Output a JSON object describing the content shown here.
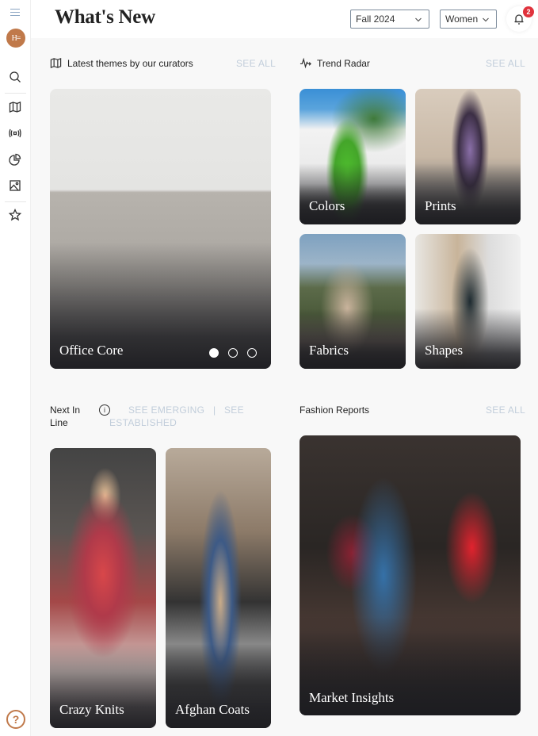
{
  "sidebar": {
    "logo_text": "H=",
    "icons": [
      "menu-icon",
      "search-icon",
      "map-icon",
      "radar-icon",
      "pie-chart-icon",
      "image-icon",
      "star-icon",
      "help-icon"
    ],
    "help_label": "?"
  },
  "header": {
    "title": "What's New",
    "season_select": {
      "value": "Fall 2024"
    },
    "gender_select": {
      "value": "Women"
    },
    "notifications": {
      "count": "2"
    }
  },
  "sections": {
    "latest_themes": {
      "title": "Latest themes by our curators",
      "see_all": "SEE ALL",
      "carousel": {
        "label": "Office Core",
        "slides": 3,
        "active_slide": 1
      }
    },
    "trend_radar": {
      "title": "Trend Radar",
      "see_all": "SEE ALL",
      "cards": [
        {
          "label": "Colors"
        },
        {
          "label": "Prints"
        },
        {
          "label": "Fabrics"
        },
        {
          "label": "Shapes"
        }
      ]
    },
    "next_in_line": {
      "title": "Next In Line",
      "see_emerging": "SEE EMERGING",
      "separator": "|",
      "see_established": "SEE ESTABLISHED",
      "cards": [
        {
          "label": "Crazy Knits"
        },
        {
          "label": "Afghan Coats"
        }
      ]
    },
    "fashion_reports": {
      "title": "Fashion Reports",
      "see_all": "SEE ALL",
      "cards": [
        {
          "label": "Market Insights"
        }
      ]
    }
  },
  "colors": {
    "brand": "#c0794a",
    "link_muted": "#c2cedb",
    "badge": "#e0323c"
  }
}
